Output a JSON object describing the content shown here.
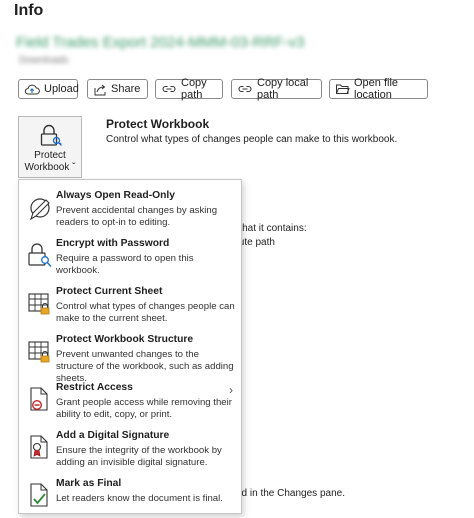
{
  "page": {
    "title": "Info",
    "filename": "Field Trades Export 2024-MMM-03-RRF-v3",
    "subpath": "Downloads"
  },
  "toolbar": {
    "upload_label": "Upload",
    "share_label": "Share",
    "copy_path_label": "Copy path",
    "copy_local_path_label": "Copy local path",
    "open_file_location_label": "Open file location"
  },
  "protect": {
    "button_line1": "Protect",
    "button_line2": "Workbook ˇ",
    "title": "Protect Workbook",
    "description": "Control what types of changes people can make to this workbook."
  },
  "background_text": {
    "line1": "e that it contains:",
    "line2": "olute path",
    "line3": "yed in the Changes pane."
  },
  "menu": {
    "items": [
      {
        "title": "Always Open Read-Only",
        "description": "Prevent accidental changes by asking readers to opt-in to editing.",
        "icon": "pencil-no-edit-icon"
      },
      {
        "title": "Encrypt with Password",
        "description": "Require a password to open this workbook.",
        "icon": "lock-search-icon"
      },
      {
        "title": "Protect Current Sheet",
        "description": "Control what types of changes people can make to the current sheet.",
        "icon": "sheet-lock-icon"
      },
      {
        "title": "Protect Workbook Structure",
        "description": "Prevent unwanted changes to the structure of the workbook, such as adding sheets.",
        "icon": "workbook-lock-icon"
      },
      {
        "title": "Restrict Access",
        "description": "Grant people access while removing their ability to edit, copy, or print.",
        "icon": "document-restrict-icon",
        "has_submenu": true
      },
      {
        "title": "Add a Digital Signature",
        "description": "Ensure the integrity of the workbook by adding an invisible digital signature.",
        "icon": "document-ribbon-icon"
      },
      {
        "title": "Mark as Final",
        "description": "Let readers know the document is final.",
        "icon": "document-check-icon"
      }
    ]
  },
  "colors": {
    "accent": "#1a6fc9",
    "lock": "#e8a626",
    "restrict": "#c4282c",
    "final": "#2e8b3a"
  }
}
